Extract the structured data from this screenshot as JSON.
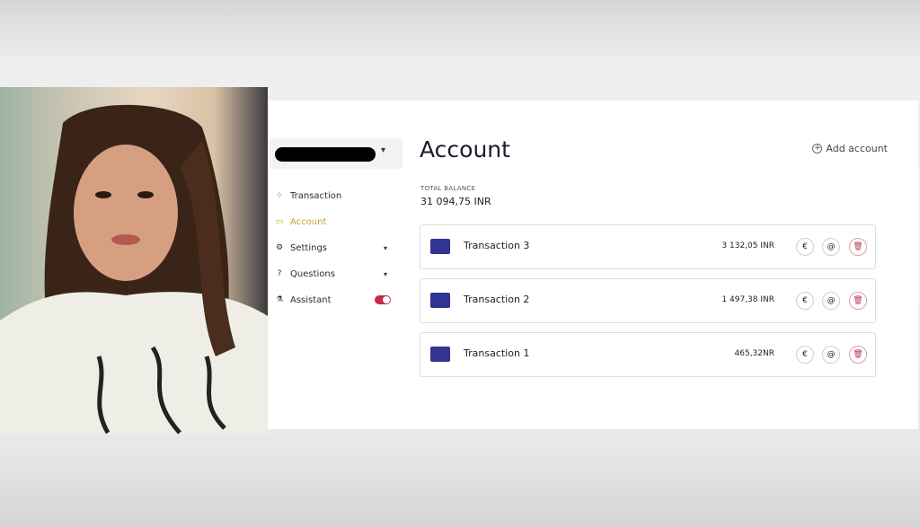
{
  "sidebar": {
    "items": [
      {
        "label": "Transaction",
        "icon": "grid-icon",
        "active": false
      },
      {
        "label": "Account",
        "icon": "card-icon",
        "active": true
      },
      {
        "label": "Settings",
        "icon": "gear-icon",
        "active": false
      },
      {
        "label": "Questions",
        "icon": "help-circle-icon",
        "active": false
      },
      {
        "label": "Assistant",
        "icon": "flask-icon",
        "active": false
      }
    ],
    "assistant_toggle_on": true
  },
  "main": {
    "title": "Account",
    "add_account_label": "Add account",
    "total_balance_label": "TOTAL BALANCE",
    "total_balance_value": "31 094,75 INR",
    "transactions": [
      {
        "name": "Transaction 3",
        "amount": "3 132,05 INR"
      },
      {
        "name": "Transaction 2",
        "amount": "1 497,38 INR"
      },
      {
        "name": "Transaction 1",
        "amount": "465,32NR"
      }
    ]
  },
  "colors": {
    "accent_active": "#c9a227",
    "card": "#2f3591",
    "toggle": "#c22a4b"
  }
}
